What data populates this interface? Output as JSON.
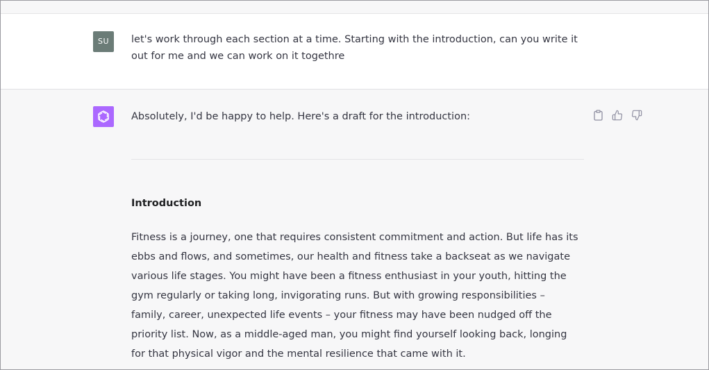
{
  "user_message": {
    "avatar_initials": "SU",
    "text": "let's work through each section at a time. Starting with the introduction, can you write it out for me and we can work on it togethre"
  },
  "assistant_message": {
    "avatar_icon": "openai-logo-icon",
    "intro": "Absolutely, I'd be happy to help. Here's a draft for the introduction:",
    "heading": "Introduction",
    "paragraph": "Fitness is a journey, one that requires consistent commitment and action. But life has its ebbs and flows, and sometimes, our health and fitness take a backseat as we navigate various life stages. You might have been a fitness enthusiast in your youth, hitting the gym regularly or taking long, invigorating runs. But with growing responsibilities – family, career, unexpected life events – your fitness may have been nudged off the priority list. Now, as a middle-aged man, you might find yourself looking back, longing for that physical vigor and the mental resilience that came with it."
  },
  "actions": {
    "copy_icon": "clipboard-icon",
    "like_icon": "thumbs-up-icon",
    "dislike_icon": "thumbs-down-icon"
  },
  "colors": {
    "bot_avatar_bg": "#ab68ff",
    "user_avatar_bg": "#6b7c77",
    "assistant_bg": "#f7f7f8",
    "text": "#343541"
  }
}
